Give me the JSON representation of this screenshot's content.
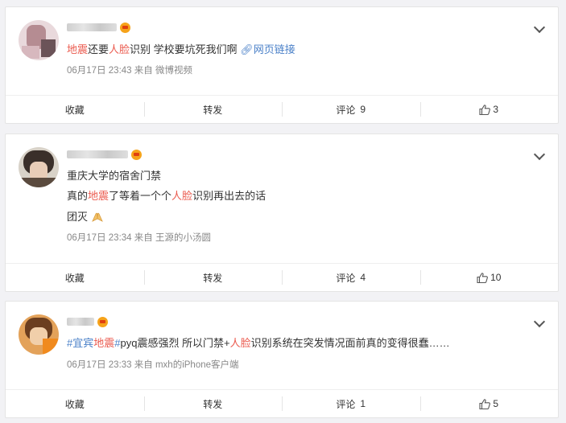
{
  "actions": {
    "collect_label": "收藏",
    "repost_label": "转发",
    "comment_label": "评论"
  },
  "posts": [
    {
      "text_parts": [
        {
          "t": "地震",
          "style": "hl"
        },
        {
          "t": "还要",
          "style": ""
        },
        {
          "t": "人脸",
          "style": "hl"
        },
        {
          "t": "识别 学校要坑死我们啊 ",
          "style": ""
        },
        {
          "t": "网页链接",
          "style": "tag"
        }
      ],
      "date": "06月17日 23:43",
      "via": "来自",
      "source": "微博视频",
      "comments": "9",
      "likes": "3"
    },
    {
      "lines": [
        [
          {
            "t": "重庆大学的宿舍门禁",
            "style": ""
          }
        ],
        [
          {
            "t": "真的",
            "style": ""
          },
          {
            "t": "地震",
            "style": "hl"
          },
          {
            "t": "了等着一个个",
            "style": ""
          },
          {
            "t": "人脸",
            "style": "hl"
          },
          {
            "t": "识别再出去的话",
            "style": ""
          }
        ],
        [
          {
            "t": "团灭",
            "style": ""
          }
        ]
      ],
      "date": "06月17日 23:34",
      "via": "来自",
      "source": "王源的小汤圆",
      "comments": "4",
      "likes": "10"
    },
    {
      "text_parts": [
        {
          "t": "#宜宾",
          "style": "tag"
        },
        {
          "t": "地震",
          "style": "hl"
        },
        {
          "t": "#",
          "style": "tag"
        },
        {
          "t": "pyq震感强烈 所以门禁+",
          "style": ""
        },
        {
          "t": "人脸",
          "style": "hl"
        },
        {
          "t": "识别系统在突发情况面前真的变得很蠢……",
          "style": ""
        }
      ],
      "date": "06月17日 23:33",
      "via": "来自",
      "source": "mxh的iPhone客户端",
      "comments": "1",
      "likes": "5"
    }
  ],
  "colors": {
    "highlight": "#eb5b4f",
    "link": "#4a80c8",
    "meta": "#888888"
  },
  "icons": {
    "verified": "crown-badge-icon",
    "more": "chevron-down-icon",
    "like": "thumb-up-icon",
    "link": "link-icon",
    "emoji": "pray-hands-emoji"
  }
}
